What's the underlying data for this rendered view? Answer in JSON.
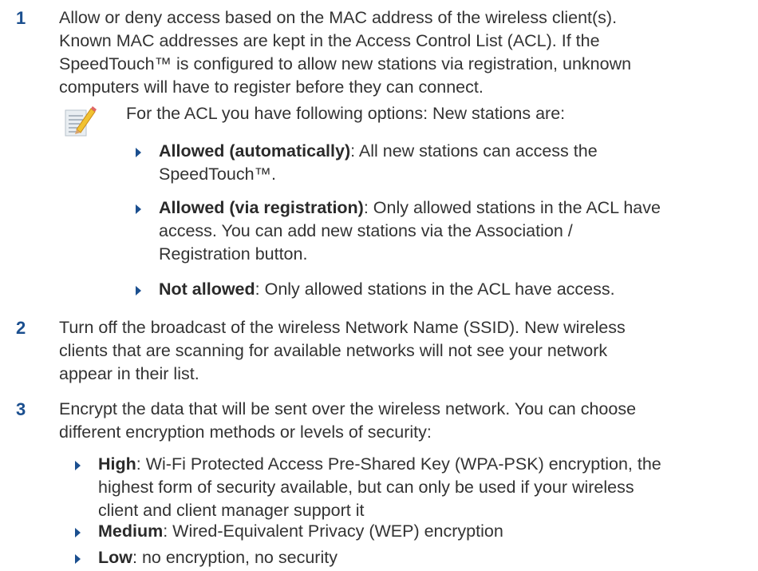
{
  "step1": {
    "number": "1",
    "lines": [
      "Allow or deny access based on the MAC address of the wireless client(s).",
      "Known MAC addresses are kept in the Access Control List (ACL). If the",
      "SpeedTouch™ is configured to allow new stations via registration, unknown",
      "computers will have to register before they can connect."
    ],
    "note_intro": "For the ACL you have following options: New stations are:",
    "options": [
      {
        "label": "Allowed (automatically)",
        "lines": [
          ": All new stations can access the",
          "SpeedTouch™."
        ]
      },
      {
        "label": "Allowed (via registration)",
        "lines": [
          ": Only allowed stations in the ACL have",
          "access. You can add new stations via the Association /",
          "Registration button."
        ]
      },
      {
        "label": "Not allowed",
        "lines": [
          ": Only allowed stations in the ACL have access."
        ]
      }
    ]
  },
  "step2": {
    "number": "2",
    "lines": [
      "Turn off the broadcast of the wireless Network Name (SSID). New wireless",
      "clients that are scanning for available networks will not see your network",
      "appear in their list."
    ]
  },
  "step3": {
    "number": "3",
    "lines": [
      "Encrypt the data that will be sent over the wireless network. You can choose",
      "different encryption methods or levels of security:"
    ],
    "levels": [
      {
        "label": "High",
        "lines": [
          ": Wi-Fi Protected Access Pre-Shared Key (WPA-PSK) encryption, the",
          "highest form of security available, but can only be used if your wireless",
          "client and client manager support it"
        ]
      },
      {
        "label": "Medium",
        "lines": [
          ": Wired-Equivalent Privacy (WEP) encryption"
        ]
      },
      {
        "label": "Low",
        "lines": [
          ": no encryption, no security"
        ]
      }
    ]
  }
}
